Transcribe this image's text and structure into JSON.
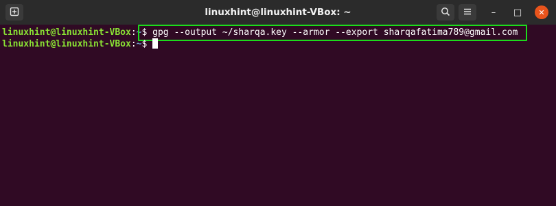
{
  "window": {
    "title": "linuxhint@linuxhint-VBox: ~",
    "new_tab_icon": "new-tab-icon",
    "search_icon": "search-icon",
    "menu_icon": "hamburger-menu-icon",
    "minimize_glyph": "–",
    "maximize_glyph": "□",
    "close_glyph": "✕"
  },
  "terminal": {
    "lines": [
      {
        "user_host": "linuxhint@linuxhint-VBox",
        "colon": ":",
        "path": "~",
        "prompt_symbol": "$",
        "command": " gpg --output ~/sharqa.key --armor --export sharqafatima789@gmail.com"
      },
      {
        "user_host": "linuxhint@linuxhint-VBox",
        "colon": ":",
        "path": "~",
        "prompt_symbol": "$",
        "command": " "
      }
    ]
  },
  "colors": {
    "terminal_bg": "#300a24",
    "prompt_user": "#8ae234",
    "prompt_path": "#729fcf",
    "highlight_border": "#1cdb1c",
    "close_button": "#e9541c"
  }
}
